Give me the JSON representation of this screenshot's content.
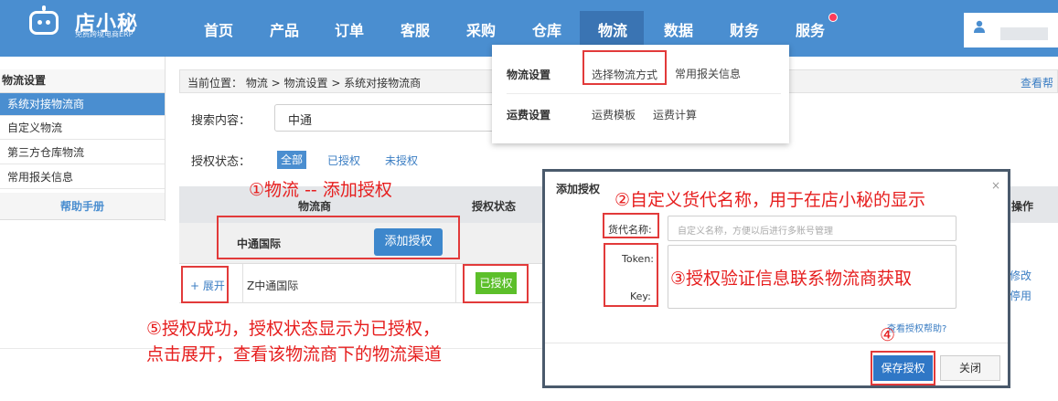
{
  "brand": {
    "name": "店小秘",
    "tagline": "免费跨境电商ERP"
  },
  "topnav": {
    "items": [
      "首页",
      "产品",
      "订单",
      "客服",
      "采购",
      "仓库",
      "物流",
      "数据",
      "财务",
      "服务"
    ],
    "active": "物流"
  },
  "dropdown": {
    "row1_label": "物流设置",
    "row1_links": [
      "选择物流方式",
      "常用报关信息"
    ],
    "row2_label": "运费设置",
    "row2_links": [
      "运费模板",
      "运费计算"
    ]
  },
  "sidebar": {
    "title": "物流设置",
    "items": [
      {
        "label": "系统对接物流商",
        "active": true
      },
      {
        "label": "自定义物流",
        "active": false
      },
      {
        "label": "第三方仓库物流",
        "active": false
      },
      {
        "label": "常用报关信息",
        "active": false
      }
    ],
    "help": "帮助手册"
  },
  "breadcrumb": {
    "text": "当前位置：  物流 >  物流设置 > 系统对接物流商",
    "help_link": "查看帮"
  },
  "search": {
    "label": "搜索内容：",
    "value": "中通"
  },
  "filter": {
    "label": "授权状态：",
    "all": "全部",
    "authorized": "已授权",
    "unauthorized": "未授权"
  },
  "table": {
    "headers": {
      "carrier": "物流商",
      "status": "授权状态",
      "ops": "操作"
    },
    "group_name": "中通国际",
    "add_auth_button": "添加授权",
    "row": {
      "expand": "+ 展开",
      "name": "Z中通国际",
      "status": "已授权",
      "op1": "修改",
      "op2": "停用"
    }
  },
  "modal": {
    "title": "添加授权",
    "close": "×",
    "name_label": "货代名称:",
    "name_placeholder": "自定义名称，方便以后进行多账号管理",
    "token_label": "Token:",
    "key_label": "Key:",
    "help_link": "查看授权帮助?",
    "save_button": "保存授权",
    "close_button": "关闭"
  },
  "annotations": {
    "a1": "①物流 -- 添加授权",
    "a2": "②自定义货代名称，用于在店小秘的显示",
    "a3": "③授权验证信息联系物流商获取",
    "a4": "④",
    "a5_line1": "⑤授权成功，授权状态显示为已授权，",
    "a5_line2": "点击展开，查看该物流商下的物流渠道"
  },
  "colors": {
    "nav": "#4a8ed0",
    "annotation": "#e23a3a",
    "success": "#5cbf2a"
  },
  "icons": [
    "robot-logo-icon",
    "user-icon",
    "notification-dot-icon",
    "close-icon"
  ]
}
